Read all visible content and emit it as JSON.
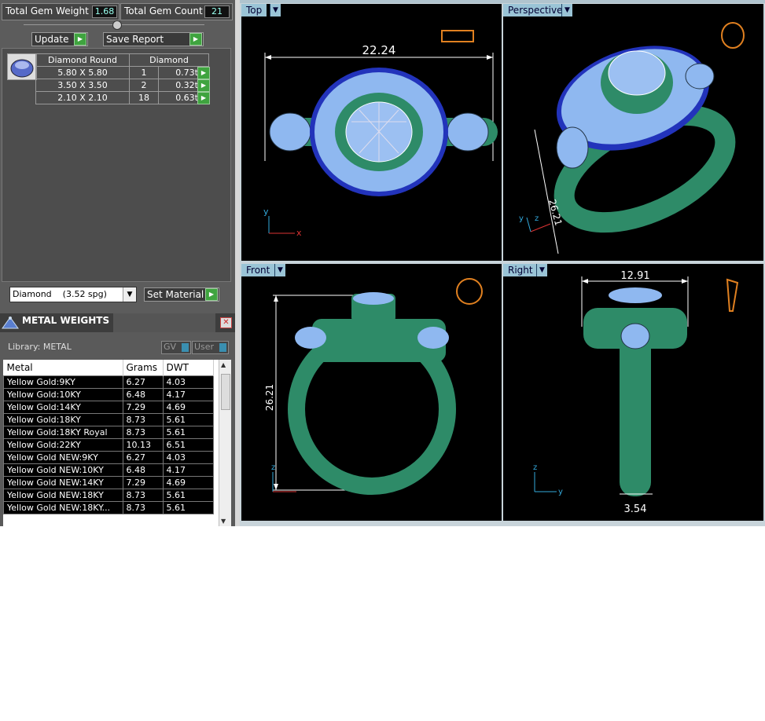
{
  "stats": {
    "total_gem_weight_label": "Total Gem Weight",
    "total_gem_weight_value": "1.68",
    "total_gem_count_label": "Total Gem Count",
    "total_gem_count_value": "21"
  },
  "actions": {
    "update_label": "Update",
    "save_report_label": "Save Report"
  },
  "gem_table": {
    "col1": "Diamond Round",
    "col2": "Diamond",
    "rows": [
      {
        "size": "5.80 X 5.80",
        "count": "1",
        "weight": "0.73tw"
      },
      {
        "size": "3.50 X 3.50",
        "count": "2",
        "weight": "0.32tw"
      },
      {
        "size": "2.10 X 2.10",
        "count": "18",
        "weight": "0.63tw"
      }
    ]
  },
  "material": {
    "selected": "Diamond    (3.52 spg)",
    "set_label": "Set Material"
  },
  "metal_weights": {
    "title": "METAL WEIGHTS",
    "library": "Library: METAL",
    "gv": "GV",
    "user": "User",
    "headers": [
      "Metal",
      "Grams",
      "DWT"
    ],
    "rows": [
      [
        "Yellow Gold:9KY",
        "6.27",
        "4.03"
      ],
      [
        "Yellow Gold:10KY",
        "6.48",
        "4.17"
      ],
      [
        "Yellow Gold:14KY",
        "7.29",
        "4.69"
      ],
      [
        "Yellow Gold:18KY",
        "8.73",
        "5.61"
      ],
      [
        "Yellow Gold:18KY Royal",
        "8.73",
        "5.61"
      ],
      [
        "Yellow Gold:22KY",
        "10.13",
        "6.51"
      ],
      [
        "Yellow Gold NEW:9KY",
        "6.27",
        "4.03"
      ],
      [
        "Yellow Gold NEW:10KY",
        "6.48",
        "4.17"
      ],
      [
        "Yellow Gold NEW:14KY",
        "7.29",
        "4.69"
      ],
      [
        "Yellow Gold NEW:18KY",
        "8.73",
        "5.61"
      ],
      [
        "Yellow Gold NEW:18KY...",
        "8.73",
        "5.61"
      ]
    ]
  },
  "viewports": {
    "top": {
      "label": "Top",
      "dim": "22.24"
    },
    "perspective": {
      "label": "Perspective",
      "dim": "26.21"
    },
    "front": {
      "label": "Front",
      "dim": "26.21"
    },
    "right": {
      "label": "Right",
      "dim_top": "12.91",
      "dim_bottom": "3.54"
    }
  },
  "colors": {
    "metal": "#2e8b68",
    "diamond": "#8fb8f0",
    "sapphire": "#2233bb",
    "viewport_bg": "#000000"
  }
}
